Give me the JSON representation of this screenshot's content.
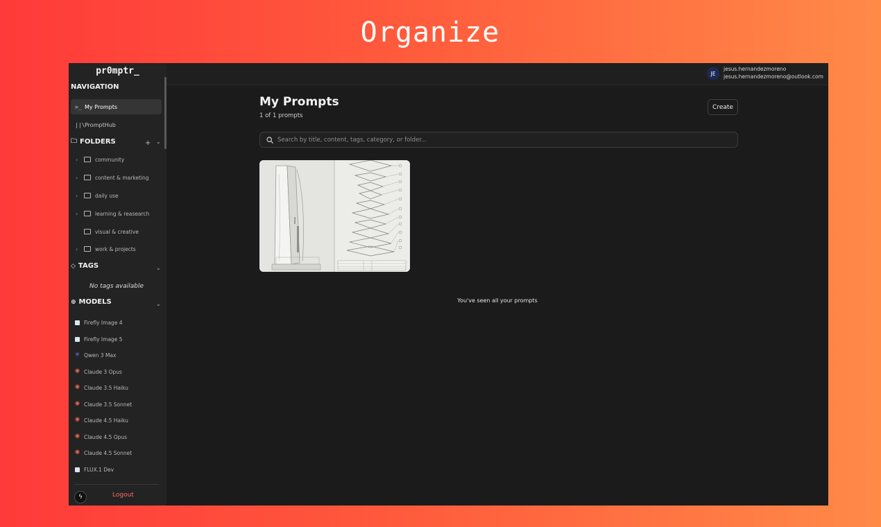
{
  "headline": "Organize",
  "app": {
    "logo": "pr0mptr_"
  },
  "navigation": {
    "heading": "NAVIGATION",
    "items": [
      {
        "label": "My Prompts",
        "icon": "terminal-icon",
        "active": true
      },
      {
        "label": "PromptHub",
        "icon": "library-icon",
        "active": false
      }
    ]
  },
  "folders": {
    "heading": "FOLDERS",
    "items": [
      {
        "label": "community",
        "expandable": true
      },
      {
        "label": "content & marketing",
        "expandable": true
      },
      {
        "label": "daily use",
        "expandable": true
      },
      {
        "label": "learning & reasearch",
        "expandable": true
      },
      {
        "label": "visual & creative",
        "expandable": false
      },
      {
        "label": "work & projects",
        "expandable": true
      }
    ]
  },
  "tags": {
    "heading": "TAGS",
    "empty": "No tags available"
  },
  "models": {
    "heading": "MODELS",
    "items": [
      {
        "label": "Firefly Image 4",
        "icon": "firefly-icon"
      },
      {
        "label": "Firefly Image 5",
        "icon": "firefly-icon"
      },
      {
        "label": "Qwen 3 Max",
        "icon": "qwen-icon"
      },
      {
        "label": "Claude 3 Opus",
        "icon": "claude-icon"
      },
      {
        "label": "Claude 3.5 Haiku",
        "icon": "claude-icon"
      },
      {
        "label": "Claude 3.5 Sonnet",
        "icon": "claude-icon"
      },
      {
        "label": "Claude 4.5 Haiku",
        "icon": "claude-icon"
      },
      {
        "label": "Claude 4.5 Opus",
        "icon": "claude-icon"
      },
      {
        "label": "Claude 4.5 Sonnet",
        "icon": "claude-icon"
      },
      {
        "label": "FLUX.1 Dev",
        "icon": "flux-icon"
      }
    ]
  },
  "footer": {
    "logout": "Logout"
  },
  "user": {
    "initials": "JE",
    "name": "jesus.hernandezmoreno",
    "email": "jesus.hernandezmoreno@outlook.com"
  },
  "main": {
    "title": "My Prompts",
    "count": "1 of 1 prompts",
    "create_label": "Create",
    "search_placeholder": "Search by title, content, tags, category, or folder...",
    "end_message": "You've seen all your prompts"
  },
  "colors": {
    "accent_logout": "#ff6a6a",
    "avatar_bg": "#1b2a57",
    "qwen": "#7b6cf6",
    "claude": "#e0644a"
  }
}
